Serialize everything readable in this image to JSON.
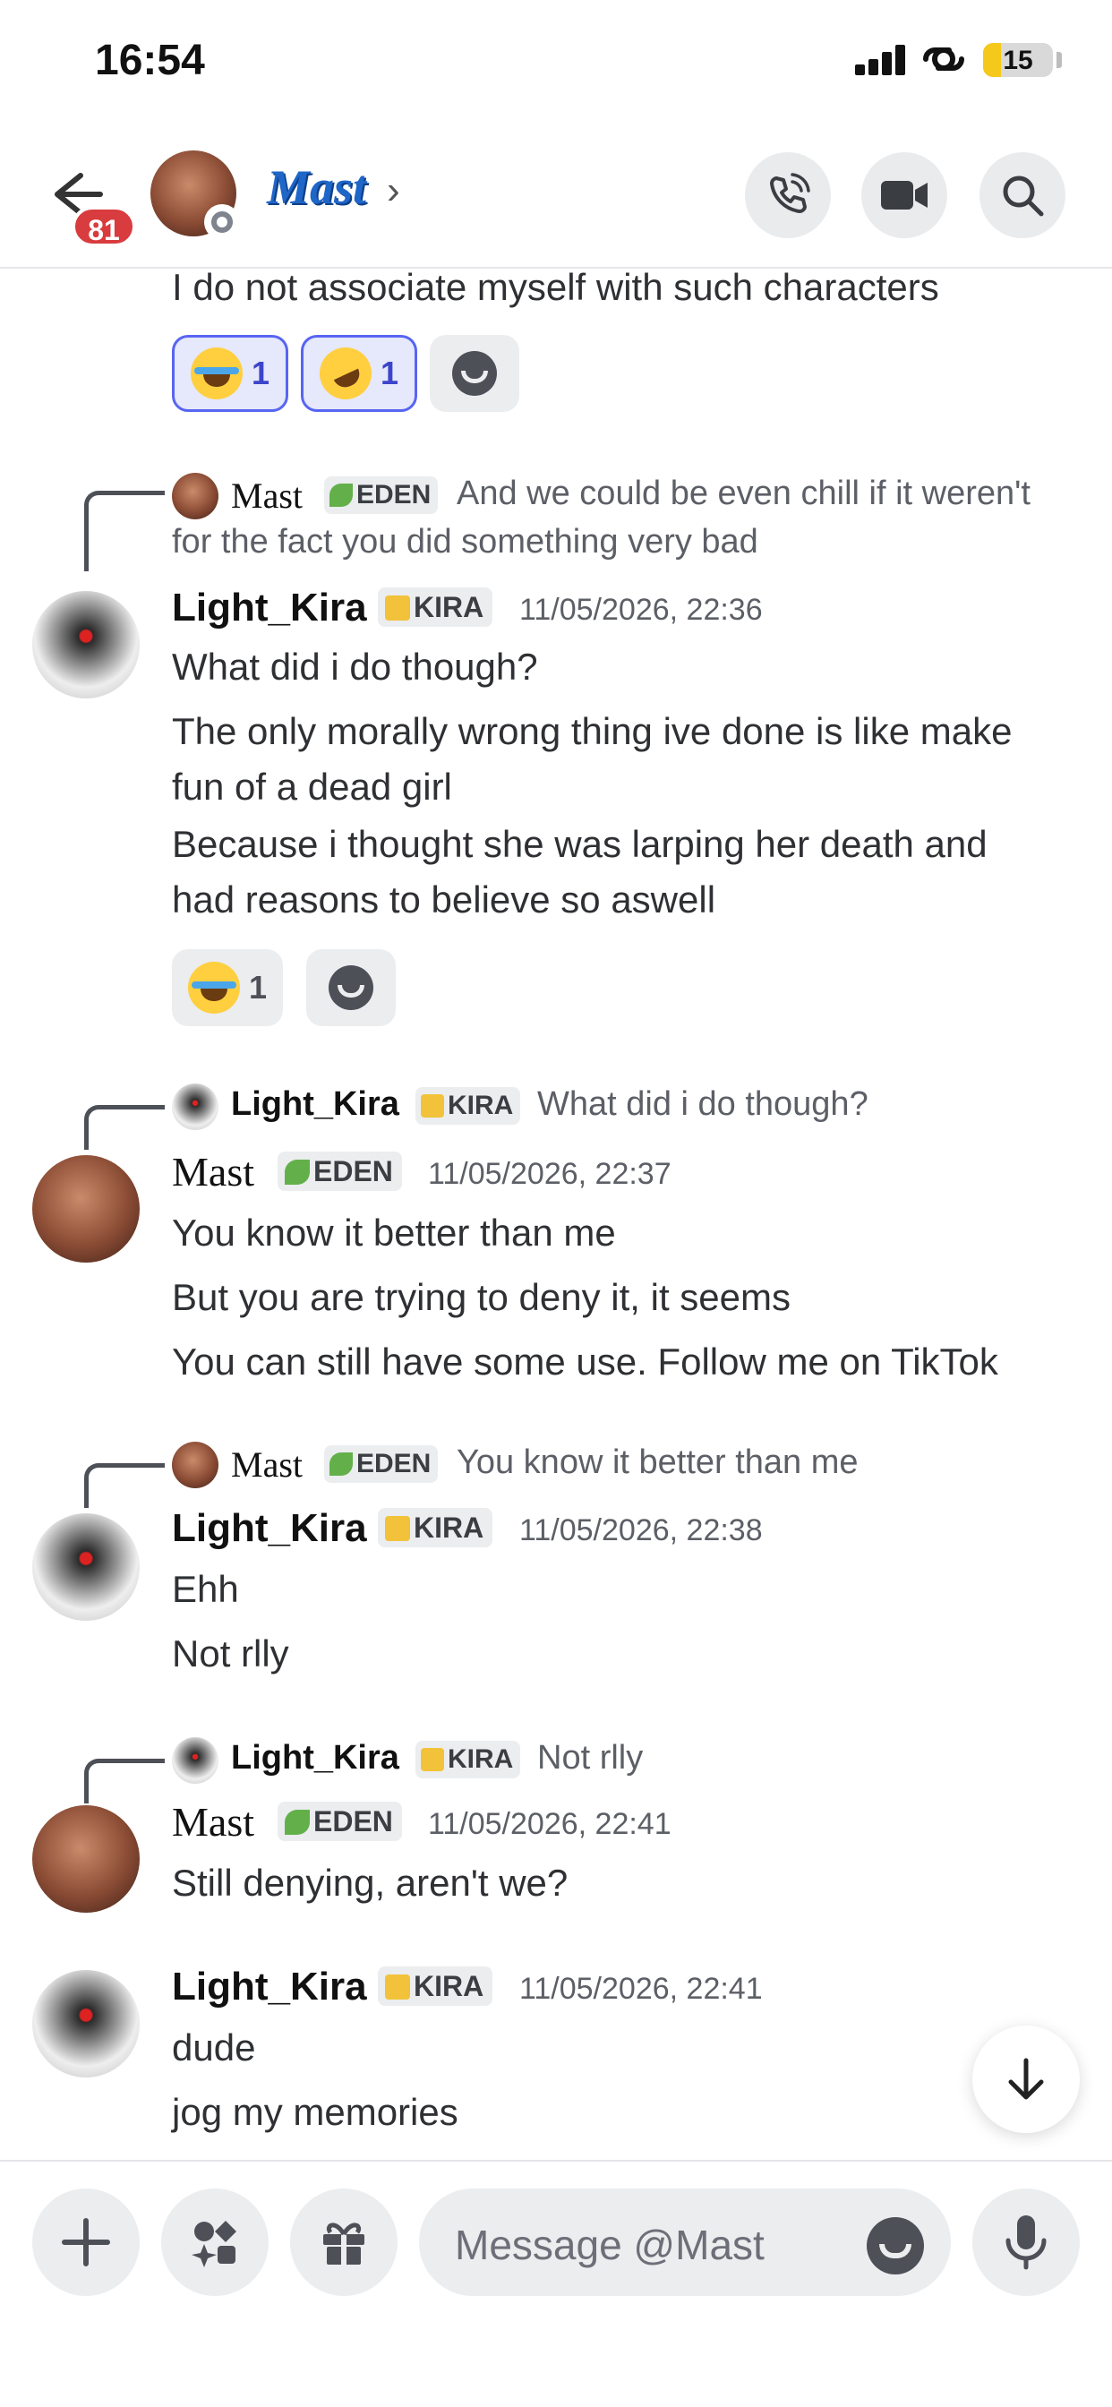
{
  "status_bar": {
    "time": "16:54",
    "battery": "15",
    "battery_level": 0.15
  },
  "header": {
    "unread_count": "81",
    "name": "Mast",
    "chevron": "›"
  },
  "composer": {
    "placeholder": "Message @Mast"
  },
  "messages": {
    "m0": {
      "text": "I do not associate myself with such characters",
      "reactions": [
        {
          "emoji": "joy-emoji",
          "count": "1"
        },
        {
          "emoji": "rofl-emoji",
          "count": "1"
        }
      ]
    },
    "m1": {
      "reply": {
        "name": "Mast",
        "tag": "EDEN",
        "text1": "And we could be even chill if it weren't",
        "text2": "for the fact you did something very bad"
      },
      "author": "Light_Kira",
      "tag": "KIRA",
      "time": "11/05/2026, 22:36",
      "lines": [
        "What did i do though?",
        "The only morally wrong thing ive done is like make",
        "fun of a dead girl",
        "Because i thought she was larping her death and",
        "had reasons to believe so aswell"
      ],
      "reaction": {
        "emoji": "sob-emoji",
        "count": "1"
      }
    },
    "m2": {
      "reply": {
        "name": "Light_Kira",
        "tag": "KIRA",
        "text": "What did i do though?"
      },
      "author": "Mast",
      "tag": "EDEN",
      "time": "11/05/2026, 22:37",
      "lines": [
        "You know it better than me",
        "But you are trying to deny it, it seems",
        "You can still have some use. Follow me on TikTok"
      ]
    },
    "m3": {
      "reply": {
        "name": "Mast",
        "tag": "EDEN",
        "text": "You know it better than me"
      },
      "author": "Light_Kira",
      "tag": "KIRA",
      "time": "11/05/2026, 22:38",
      "lines": [
        "Ehh",
        "Not rlly"
      ]
    },
    "m4": {
      "reply": {
        "name": "Light_Kira",
        "tag": "KIRA",
        "text": "Not rlly"
      },
      "author": "Mast",
      "tag": "EDEN",
      "time": "11/05/2026, 22:41",
      "lines": [
        "Still denying, aren't we?"
      ]
    },
    "m5": {
      "author": "Light_Kira",
      "tag": "KIRA",
      "time": "11/05/2026, 22:41",
      "lines": [
        "dude",
        "jog my memories"
      ]
    }
  }
}
